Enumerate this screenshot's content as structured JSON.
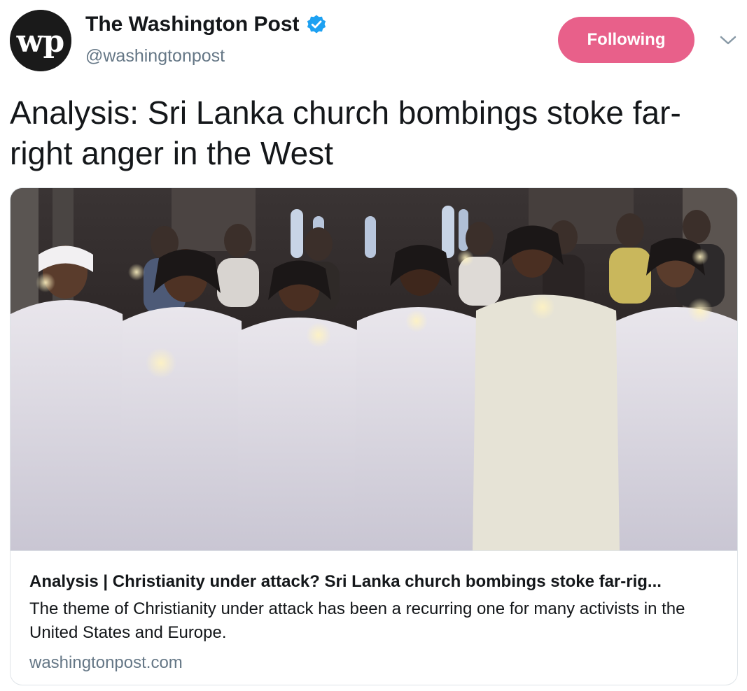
{
  "account": {
    "display_name": "The Washington Post",
    "handle": "@washingtonpost",
    "avatar_text": "wp",
    "verified": true
  },
  "follow_button": {
    "label": "Following"
  },
  "menu": {
    "icon": "chevron-down-icon"
  },
  "tweet": {
    "text": "Analysis: Sri Lanka church bombings stoke far-right anger in the West"
  },
  "link_card": {
    "title": "Analysis | Christianity under attack? Sri Lanka church bombings stoke far-rig...",
    "description": "The theme of Christianity under attack has been a recurring one for many activists in the United States and Europe.",
    "domain": "washingtonpost.com"
  },
  "colors": {
    "follow_button": "#e0245e",
    "verified_badge": "#1da1f2",
    "secondary_text": "#657786"
  }
}
